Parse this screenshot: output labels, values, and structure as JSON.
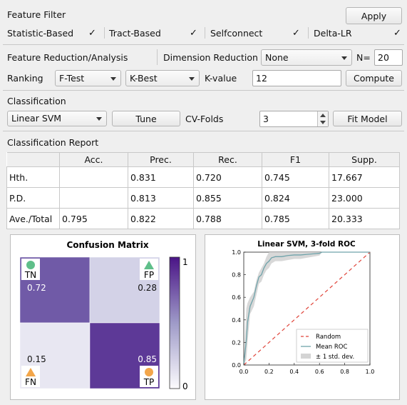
{
  "feature_filter": {
    "title": "Feature Filter",
    "apply_label": "Apply",
    "options": [
      {
        "label": "Statistic-Based",
        "checked": true
      },
      {
        "label": "Tract-Based",
        "checked": true
      },
      {
        "label": "Selfconnect",
        "checked": true
      },
      {
        "label": "Delta-LR",
        "checked": true
      }
    ]
  },
  "reduction": {
    "title": "Feature Reduction/Analysis",
    "dim_label": "Dimension Reduction",
    "dim_value": "None",
    "n_label": "N=",
    "n_value": "20",
    "ranking_label": "Ranking",
    "ranking_value": "F-Test",
    "selector_value": "K-Best",
    "k_label": "K-value",
    "k_value": "12",
    "compute_label": "Compute"
  },
  "classification": {
    "title": "Classification",
    "model_value": "Linear SVM",
    "tune_label": "Tune",
    "cv_label": "CV-Folds",
    "cv_value": "3",
    "fit_label": "Fit Model"
  },
  "report": {
    "title": "Classification Report",
    "columns": [
      "Acc.",
      "Prec.",
      "Rec.",
      "F1",
      "Supp."
    ],
    "rows": [
      {
        "name": "Hth.",
        "cells": [
          "",
          "0.831",
          "0.720",
          "0.745",
          "17.667"
        ]
      },
      {
        "name": "P.D.",
        "cells": [
          "",
          "0.813",
          "0.855",
          "0.824",
          "23.000"
        ]
      },
      {
        "name": "Ave./Total",
        "cells": [
          "0.795",
          "0.822",
          "0.788",
          "0.785",
          "20.333"
        ]
      }
    ]
  },
  "chart_data": [
    {
      "type": "heatmap",
      "title": "Confusion Matrix",
      "cells": [
        {
          "label": "TN",
          "value": 0.72,
          "value_label": "0.72",
          "marker": "circle",
          "marker_color": "#5fbf8a"
        },
        {
          "label": "FP",
          "value": 0.28,
          "value_label": "0.28",
          "marker": "triangle",
          "marker_color": "#5fbf8a"
        },
        {
          "label": "FN",
          "value": 0.15,
          "value_label": "0.15",
          "marker": "triangle",
          "marker_color": "#f3a64a"
        },
        {
          "label": "TP",
          "value": 0.85,
          "value_label": "0.85",
          "marker": "circle",
          "marker_color": "#f3a64a"
        }
      ],
      "colorbar": {
        "min": 0,
        "max": 1,
        "tick_labels": [
          "1",
          "0"
        ],
        "low_color": "#fcfbfd",
        "high_color": "#4a1486"
      }
    },
    {
      "type": "line",
      "title": "Linear SVM, 3-fold ROC",
      "xlim": [
        0,
        1
      ],
      "ylim": [
        0,
        1
      ],
      "x_ticks": [
        "0.0",
        "0.2",
        "0.4",
        "0.6",
        "0.8",
        "1.0"
      ],
      "y_ticks": [
        "0.0",
        "0.2",
        "0.4",
        "0.6",
        "0.8",
        "1.0"
      ],
      "legend_position": "bottom-right",
      "legend": [
        "Random",
        "Mean ROC",
        "± 1 std. dev."
      ],
      "random": {
        "x": [
          0,
          1
        ],
        "y": [
          0,
          1
        ],
        "color": "#e0443a"
      },
      "mean_roc": {
        "color": "#6fa3aa",
        "x": [
          0,
          0.02,
          0.03,
          0.05,
          0.08,
          0.1,
          0.12,
          0.14,
          0.16,
          0.18,
          0.2,
          0.22,
          0.25,
          0.3,
          0.35,
          0.4,
          0.45,
          0.5,
          0.55,
          0.6,
          0.62,
          0.65,
          0.7,
          0.8,
          0.9,
          1.0
        ],
        "y": [
          0,
          0.22,
          0.38,
          0.52,
          0.6,
          0.7,
          0.78,
          0.8,
          0.86,
          0.9,
          0.92,
          0.95,
          0.96,
          0.96,
          0.97,
          0.975,
          0.975,
          0.98,
          0.985,
          0.99,
          1.0,
          1.0,
          1.0,
          1.0,
          1.0,
          1.0
        ]
      },
      "std_band": {
        "color": "#d4d4d4",
        "upper": [
          0,
          0.5,
          0.55,
          0.6,
          0.65,
          0.75,
          0.82,
          0.86,
          0.9,
          0.96,
          1.0,
          1.0,
          1.0,
          1.0,
          1.0,
          1.0,
          1.0,
          1.0,
          1.0,
          1.0,
          1.0,
          1.0,
          1.0,
          1.0,
          1.0,
          1.0
        ],
        "lower": [
          0,
          0.05,
          0.2,
          0.45,
          0.52,
          0.62,
          0.72,
          0.74,
          0.8,
          0.84,
          0.86,
          0.9,
          0.92,
          0.92,
          0.93,
          0.94,
          0.94,
          0.95,
          0.96,
          0.97,
          1.0,
          1.0,
          1.0,
          1.0,
          1.0,
          1.0
        ]
      }
    }
  ]
}
